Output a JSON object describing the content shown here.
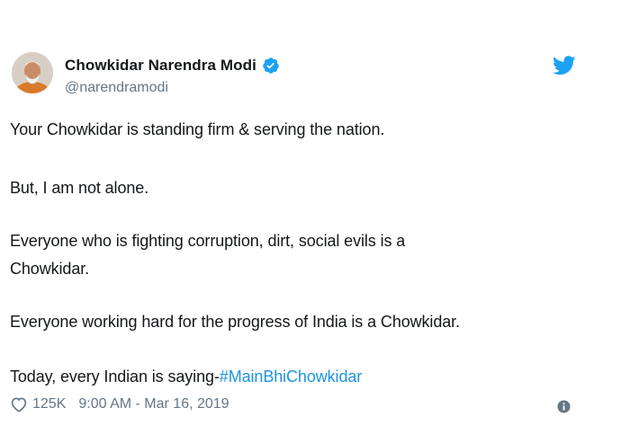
{
  "author": {
    "name": "Chowkidar Narendra Modi",
    "handle": "@narendramodi"
  },
  "tweet": {
    "line1": "Your Chowkidar is standing firm & serving the nation.",
    "line2": "But, I am not alone.",
    "line3": "Everyone who is fighting corruption, dirt, social evils is a",
    "line4": "Chowkidar.",
    "line5": "Everyone working hard for the progress of India is a Chowkidar.",
    "line6_prefix": "Today, every Indian is saying-",
    "hashtag": "#MainBhiChowkidar"
  },
  "meta": {
    "likes": "125K",
    "timestamp": "9:00 AM - Mar 16, 2019"
  },
  "icons": {
    "verified": "verified-badge-icon",
    "brand": "twitter-bird-icon",
    "like": "heart-icon",
    "info": "info-icon"
  },
  "colors": {
    "brand": "#1da1f2",
    "hashtag": "#1b95e0",
    "text": "#14171a",
    "muted": "#657786"
  }
}
